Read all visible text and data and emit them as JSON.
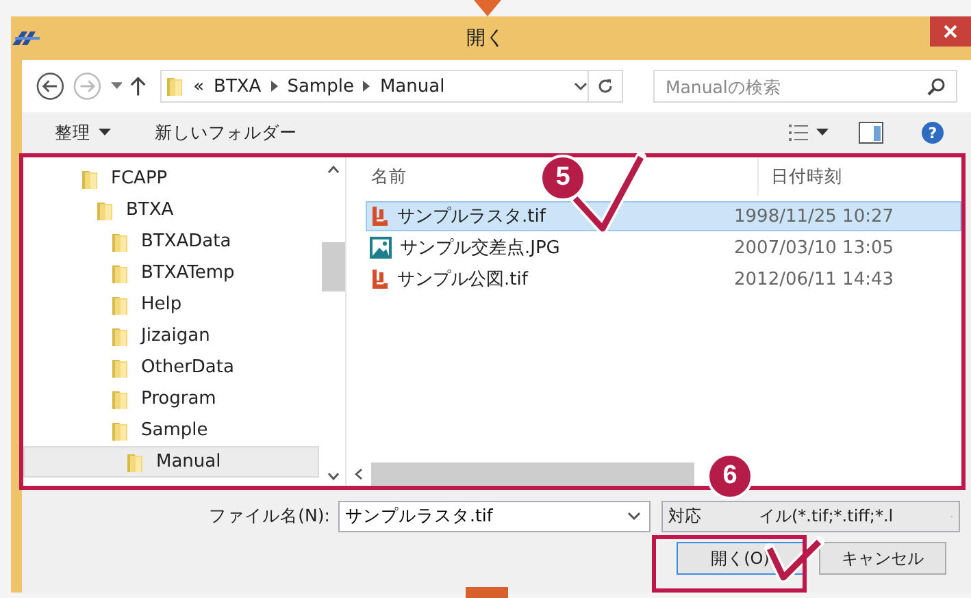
{
  "window": {
    "title": "開く"
  },
  "navigation": {
    "overflow": "«",
    "path": [
      "BTXA",
      "Sample",
      "Manual"
    ],
    "search_placeholder": "Manualの検索"
  },
  "toolbar": {
    "organize": "整理",
    "new_folder": "新しいフォルダー",
    "help": "?"
  },
  "folder_tree": [
    {
      "label": "FCAPP",
      "selected": false,
      "children": [
        {
          "label": "BTXA",
          "selected": false,
          "children": [
            {
              "label": "BTXAData",
              "selected": false
            },
            {
              "label": "BTXATemp",
              "selected": false
            },
            {
              "label": "Help",
              "selected": false
            },
            {
              "label": "Jizaigan",
              "selected": false
            },
            {
              "label": "OtherData",
              "selected": false
            },
            {
              "label": "Program",
              "selected": false
            },
            {
              "label": "Sample",
              "selected": false,
              "children": [
                {
                  "label": "Manual",
                  "selected": true
                }
              ]
            }
          ]
        }
      ]
    }
  ],
  "file_list": {
    "columns": [
      "名前",
      "日付時刻"
    ],
    "rows": [
      {
        "name": "サンプルラスタ.tif",
        "date": "1998/11/25 10:27",
        "kind": "tif",
        "selected": true
      },
      {
        "name": "サンプル交差点.JPG",
        "date": "2007/03/10 13:05",
        "kind": "image",
        "selected": false
      },
      {
        "name": "サンプル公図.tif",
        "date": "2012/06/11 14:43",
        "kind": "tif",
        "selected": false
      }
    ]
  },
  "footer": {
    "filename_label": "ファイル名(N):",
    "filename_value": "サンプルラスタ.tif",
    "filetype_visible_parts": [
      "対応",
      "イル(*.tif;*.tiff;*.l"
    ],
    "buttons": [
      {
        "label": "開く(O)",
        "default": true
      },
      {
        "label": "キャンセル",
        "default": false
      }
    ]
  },
  "annotations": [
    {
      "number": "5"
    },
    {
      "number": "6"
    }
  ]
}
